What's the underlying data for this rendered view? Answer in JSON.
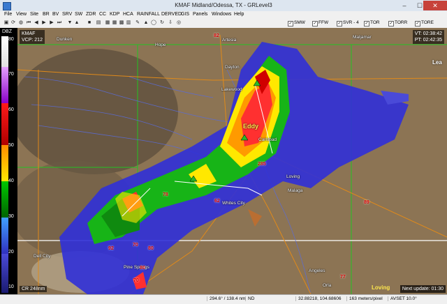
{
  "window": {
    "title": "KMAF Midland/Odessa, TX - GRLevel3",
    "minimize": "–",
    "maximize": "☐",
    "close": "✕"
  },
  "menu": [
    "File",
    "View",
    "Site",
    "BR",
    "BV",
    "SRV",
    "SW",
    "ZDR",
    "CC",
    "KDP",
    "HCA",
    "RAINFALL",
    "DERVED",
    "GIS",
    "Panels",
    "Windows",
    "Help"
  ],
  "toggles": [
    {
      "label": "SMW",
      "checked": true
    },
    {
      "label": "FFW",
      "checked": true
    },
    {
      "label": "SVR - 4",
      "checked": true
    },
    {
      "label": "TOR",
      "checked": true
    },
    {
      "label": "TORR",
      "checked": true
    },
    {
      "label": "TORE",
      "checked": true
    }
  ],
  "radar": {
    "site": "KMAF",
    "vcp": "VCP: 212",
    "vt": "VT: 02:38:42",
    "pt": "PT: 02:42:35",
    "product": "CR 248nm",
    "next_update": "Next update: 01:30"
  },
  "scale": {
    "title": "DBZ",
    "ticks": [
      "80",
      "70",
      "60",
      "50",
      "40",
      "30",
      "20",
      "10"
    ]
  },
  "status": {
    "azimuth": "294.6° / 138.4 nm",
    "nd": "ND",
    "coords": "32.88218, 104.68606",
    "res": "163 meters/pixel",
    "avset": "AVSET 10.0°"
  },
  "cities": [
    {
      "name": "Dunken"
    },
    {
      "name": "Hope"
    },
    {
      "name": "Artesia"
    },
    {
      "name": "Maljamar"
    },
    {
      "name": "Dayton"
    },
    {
      "name": "Lakewood"
    },
    {
      "name": "Carlsbad"
    },
    {
      "name": "Loving"
    },
    {
      "name": "Malaga"
    },
    {
      "name": "Whites City"
    },
    {
      "name": "Dell City"
    },
    {
      "name": "Pine Springs"
    },
    {
      "name": "Angeles"
    },
    {
      "name": "Orla"
    }
  ],
  "county_label": "Eddy",
  "lea_label": "Lea",
  "loving_label": "Loving",
  "highways": [
    "82",
    "285",
    "62",
    "78",
    "180",
    "54",
    "92",
    "70",
    "80",
    "70",
    "77",
    "89",
    "285"
  ],
  "colors": {
    "titlebar": "#dde6f0",
    "map_bg": "#8a7152",
    "close": "#c7423a",
    "label_red": "#d40000",
    "county": "#ffe84d"
  }
}
